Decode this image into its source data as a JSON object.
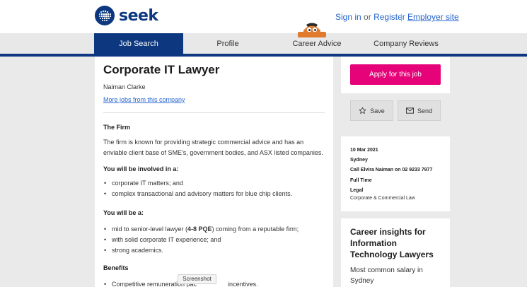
{
  "header": {
    "brand": "seek",
    "sign_in": "Sign in",
    "or": "or",
    "register": "Register",
    "separator": "|",
    "employer_site": "Employer site"
  },
  "nav": {
    "tabs": [
      {
        "label": "Job Search",
        "active": true
      },
      {
        "label": "Profile",
        "active": false
      },
      {
        "label": "Career Advice",
        "active": false
      },
      {
        "label": "Company Reviews",
        "active": false
      }
    ]
  },
  "job": {
    "title": "Corporate IT Lawyer",
    "advertiser": "Naiman Clarke",
    "more_jobs": "More jobs from this company",
    "firm_heading": "The Firm",
    "firm_text": "The firm is known for providing strategic commercial advice and has an enviable client base of SME's, government bodies, and ASX listed companies.",
    "involved_heading": "You will be involved in a:",
    "involved_items": [
      "corporate IT matters; and",
      "complex transactional and advisory matters for blue chip clients."
    ],
    "will_be_heading": "You will be a:",
    "will_be_items": [
      {
        "pre": "mid to senior-level lawyer (",
        "bold": "4-8 PQE",
        "post": ") coming from a reputable firm;"
      },
      {
        "pre": "with solid corporate IT experience; and",
        "bold": "",
        "post": ""
      },
      {
        "pre": "strong academics.",
        "bold": "",
        "post": ""
      }
    ],
    "benefits_heading": "Benefits",
    "benefits_items": [
      "Competitive remuneration pac",
      "incentives."
    ]
  },
  "tooltip": "Screenshot",
  "sidebar": {
    "apply_label": "Apply for this job",
    "save_label": "Save",
    "send_label": "Send",
    "date": "10 Mar 2021",
    "location": "Sydney",
    "contact": "Call Elvira Naiman on 02 9233 7977",
    "work_type": "Full Time",
    "category": "Legal",
    "subcategory": "Corporate & Commercial Law",
    "insights_title": "Career insights for Information Technology Lawyers",
    "insights_sub": "Most common salary in Sydney"
  },
  "colors": {
    "brand_blue": "#0d3880",
    "link_blue": "#2765cf",
    "apply_pink": "#e60278"
  }
}
